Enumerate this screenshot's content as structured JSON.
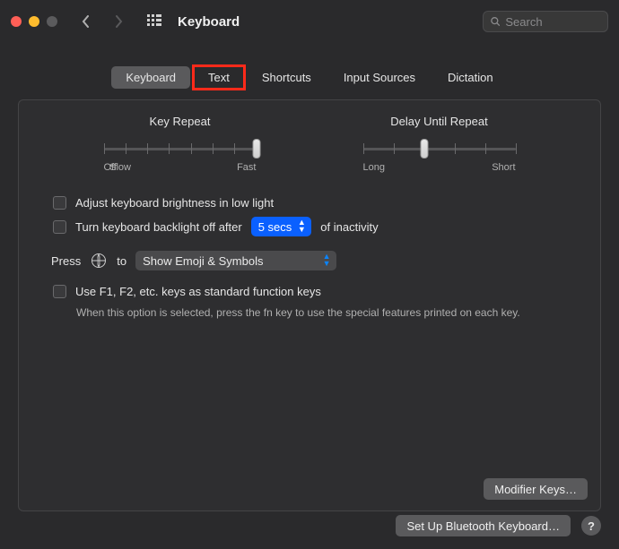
{
  "titlebar": {
    "title": "Keyboard",
    "search_placeholder": "Search"
  },
  "tabs": [
    {
      "label": "Keyboard",
      "active": true
    },
    {
      "label": "Text",
      "highlighted": true
    },
    {
      "label": "Shortcuts"
    },
    {
      "label": "Input Sources"
    },
    {
      "label": "Dictation"
    }
  ],
  "sliders": {
    "key_repeat": {
      "title": "Key Repeat",
      "labels": [
        "Off",
        "Slow",
        "Fast"
      ],
      "ticks": 8,
      "value_index": 7
    },
    "delay_until_repeat": {
      "title": "Delay Until Repeat",
      "labels": [
        "Long",
        "Short"
      ],
      "ticks": 6,
      "value_index": 2
    }
  },
  "options": {
    "adjust_brightness_label": "Adjust keyboard brightness in low light",
    "adjust_brightness_checked": false,
    "backlight_off_label_pre": "Turn keyboard backlight off after",
    "backlight_off_value": "5 secs",
    "backlight_off_label_post": "of inactivity",
    "backlight_off_checked": false,
    "press_label_pre": "Press",
    "press_label_post": "to",
    "press_action_value": "Show Emoji & Symbols",
    "fn_keys_label": "Use F1, F2, etc. keys as standard function keys",
    "fn_keys_checked": false,
    "fn_keys_desc": "When this option is selected, press the fn key to use the special features printed on each key."
  },
  "buttons": {
    "modifier_keys": "Modifier Keys…",
    "setup_bluetooth": "Set Up Bluetooth Keyboard…",
    "help": "?"
  }
}
